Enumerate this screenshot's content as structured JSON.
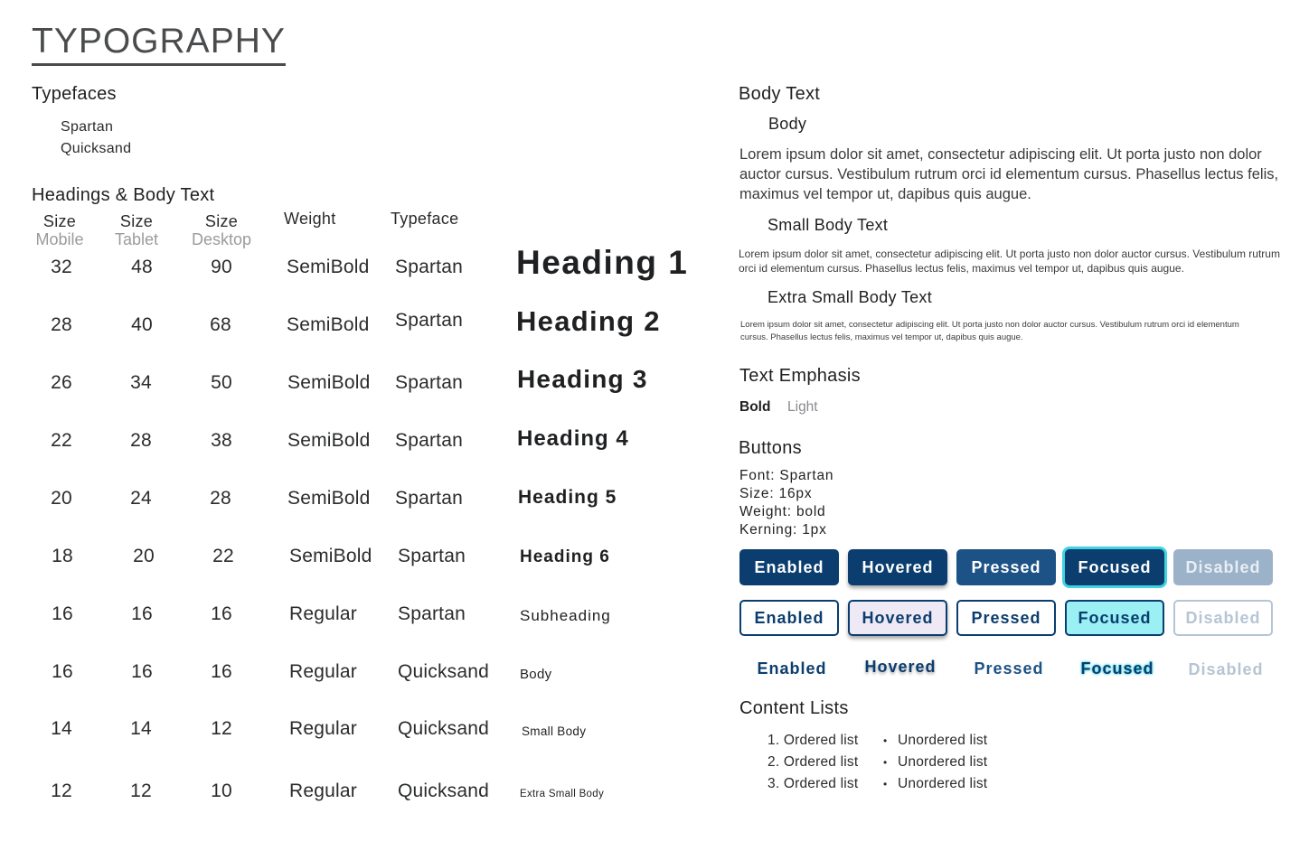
{
  "title": "TYPOGRAPHY",
  "typefaces": {
    "heading": "Typefaces",
    "items": [
      "Spartan",
      "Quicksand"
    ]
  },
  "headings_body": {
    "heading": "Headings & Body Text",
    "columns": {
      "size": "Size",
      "mobile": "Mobile",
      "tablet": "Tablet",
      "desktop": "Desktop",
      "weight": "Weight",
      "typeface": "Typeface"
    },
    "rows": [
      {
        "mobile": "32",
        "tablet": "48",
        "desktop": "90",
        "weight": "SemiBold",
        "typeface": "Spartan",
        "sample": "Heading 1"
      },
      {
        "mobile": "28",
        "tablet": "40",
        "desktop": "68",
        "weight": "SemiBold",
        "typeface": "Spartan",
        "sample": "Heading 2"
      },
      {
        "mobile": "26",
        "tablet": "34",
        "desktop": "50",
        "weight": "SemiBold",
        "typeface": "Spartan",
        "sample": "Heading 3"
      },
      {
        "mobile": "22",
        "tablet": "28",
        "desktop": "38",
        "weight": "SemiBold",
        "typeface": "Spartan",
        "sample": "Heading 4"
      },
      {
        "mobile": "20",
        "tablet": "24",
        "desktop": "28",
        "weight": "SemiBold",
        "typeface": "Spartan",
        "sample": "Heading 5"
      },
      {
        "mobile": "18",
        "tablet": "20",
        "desktop": "22",
        "weight": "SemiBold",
        "typeface": "Spartan",
        "sample": "Heading 6"
      },
      {
        "mobile": "16",
        "tablet": "16",
        "desktop": "16",
        "weight": "Regular",
        "typeface": "Spartan",
        "sample": "Subheading"
      },
      {
        "mobile": "16",
        "tablet": "16",
        "desktop": "16",
        "weight": "Regular",
        "typeface": "Quicksand",
        "sample": "Body"
      },
      {
        "mobile": "14",
        "tablet": "14",
        "desktop": "12",
        "weight": "Regular",
        "typeface": "Quicksand",
        "sample": "Small Body"
      },
      {
        "mobile": "12",
        "tablet": "12",
        "desktop": "10",
        "weight": "Regular",
        "typeface": "Quicksand",
        "sample": "Extra Small Body"
      }
    ]
  },
  "body_text": {
    "heading": "Body Text",
    "body_label": "Body",
    "body_para": "Lorem ipsum dolor sit amet, consectetur adipiscing elit. Ut porta justo non dolor auctor cursus. Vestibulum rutrum orci id elementum cursus. Phasellus lectus felis, maximus vel tempor ut, dapibus quis augue.",
    "small_label": "Small Body Text",
    "small_para": "Lorem ipsum dolor sit amet, consectetur adipiscing elit. Ut porta justo non dolor auctor cursus. Vestibulum rutrum orci id elementum cursus. Phasellus lectus felis, maximus vel tempor ut, dapibus quis augue.",
    "xsmall_label": "Extra Small Body Text",
    "xsmall_para": "Lorem ipsum dolor sit amet, consectetur adipiscing elit. Ut porta justo non dolor auctor cursus. Vestibulum rutrum orci id elementum cursus. Phasellus lectus felis, maximus vel tempor ut, dapibus quis augue."
  },
  "emphasis": {
    "heading": "Text Emphasis",
    "bold": "Bold",
    "light": "Light"
  },
  "buttons": {
    "heading": "Buttons",
    "specs": [
      "Font: Spartan",
      "Size: 16px",
      "Weight: bold",
      "Kerning: 1px"
    ],
    "states": [
      "Enabled",
      "Hovered",
      "Pressed",
      "Focused",
      "Disabled"
    ],
    "colors": {
      "primary": "#0b3d6e",
      "focus_ring": "#3fd3e4",
      "disabled": "#9bb2c8"
    }
  },
  "lists": {
    "heading": "Content Lists",
    "ordered": [
      "1. Ordered list",
      "2. Ordered list",
      "3. Ordered list"
    ],
    "unordered": [
      "Unordered list",
      "Unordered list",
      "Unordered list"
    ]
  }
}
